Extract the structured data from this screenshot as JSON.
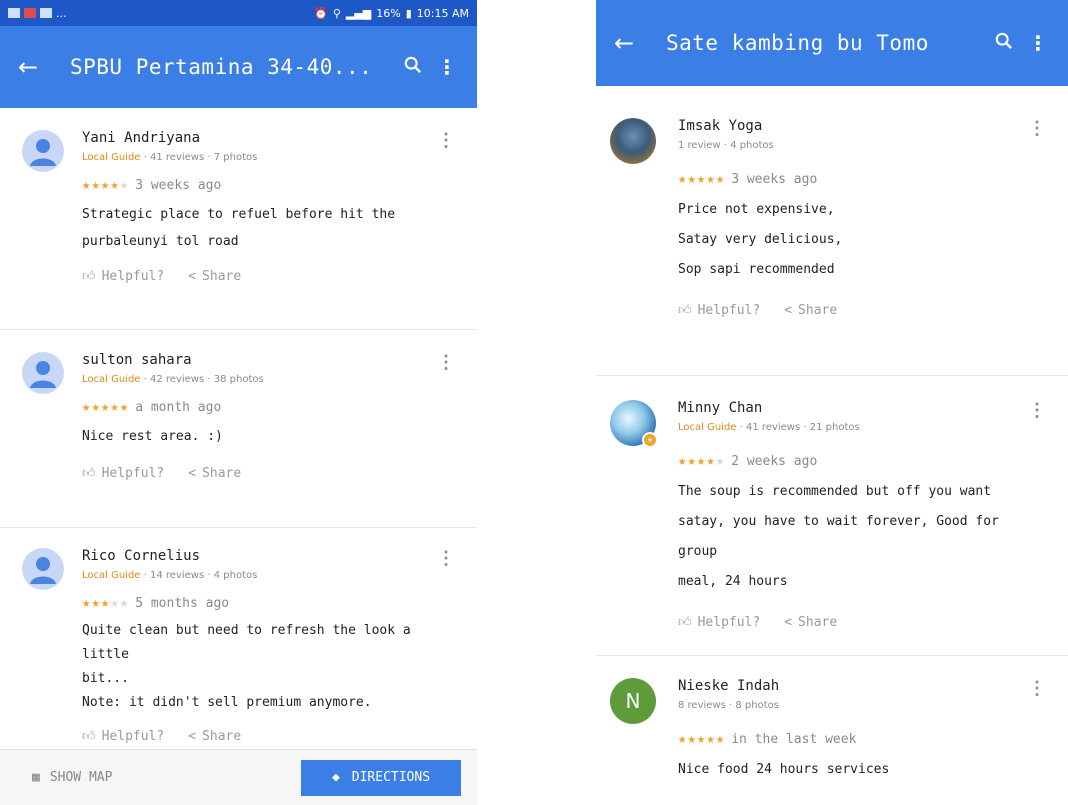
{
  "left": {
    "statusbar": {
      "time": "10:15 AM",
      "battery": "16%"
    },
    "appbar": {
      "title": "SPBU Pertamina 34-40..."
    },
    "reviews": [
      {
        "name": "Yani Andriyana",
        "local_guide": "Local Guide",
        "meta": "41 reviews · 7 photos",
        "stars": 4,
        "time": "3 weeks ago",
        "text_lines": [
          "Strategic place to refuel before hit the",
          "purbaleunyi tol road"
        ],
        "helpful": "Helpful?",
        "share": "Share"
      },
      {
        "name": "sulton sahara",
        "local_guide": "Local Guide",
        "meta": "42 reviews · 38 photos",
        "stars": 5,
        "time": "a month ago",
        "text_lines": [
          "Nice rest area. :)"
        ],
        "helpful": "Helpful?",
        "share": "Share"
      },
      {
        "name": "Rico Cornelius",
        "local_guide": "Local Guide",
        "meta": "14 reviews · 4 photos",
        "stars": 3,
        "time": "5 months ago",
        "text_lines": [
          "Quite clean but need to refresh the look a little",
          "bit...",
          "Note: it didn't sell premium anymore."
        ],
        "helpful": "Helpful?",
        "share": "Share"
      }
    ],
    "bottombar": {
      "show_map": "SHOW MAP",
      "directions": "DIRECTIONS"
    }
  },
  "right": {
    "appbar": {
      "title": "Sate kambing bu Tomo"
    },
    "reviews": [
      {
        "name": "Imsak Yoga",
        "local_guide": "",
        "meta": "1 review · 4 photos",
        "stars": 5,
        "time": "3 weeks ago",
        "text_lines": [
          "Price not expensive,",
          "Satay very delicious,",
          "Sop sapi recommended"
        ],
        "helpful": "Helpful?",
        "share": "Share"
      },
      {
        "name": "Minny Chan",
        "local_guide": "Local Guide",
        "meta": "41 reviews · 21 photos",
        "stars": 4,
        "time": "2 weeks ago",
        "text_lines": [
          "The soup is recommended but off you want",
          "satay, you have to wait forever, Good for group",
          "meal, 24 hours"
        ],
        "helpful": "Helpful?",
        "share": "Share"
      },
      {
        "name": "Nieske Indah",
        "local_guide": "",
        "meta": "8 reviews · 8 photos",
        "stars": 5,
        "time": "in the last week",
        "text_lines": [
          "Nice food 24 hours services"
        ],
        "avatar_letter": "N"
      }
    ]
  },
  "colors": {
    "appbar": "#3a7ee6",
    "statusbar": "#1e58c7",
    "star": "#f0a32a",
    "local_guide": "#e08a14"
  }
}
